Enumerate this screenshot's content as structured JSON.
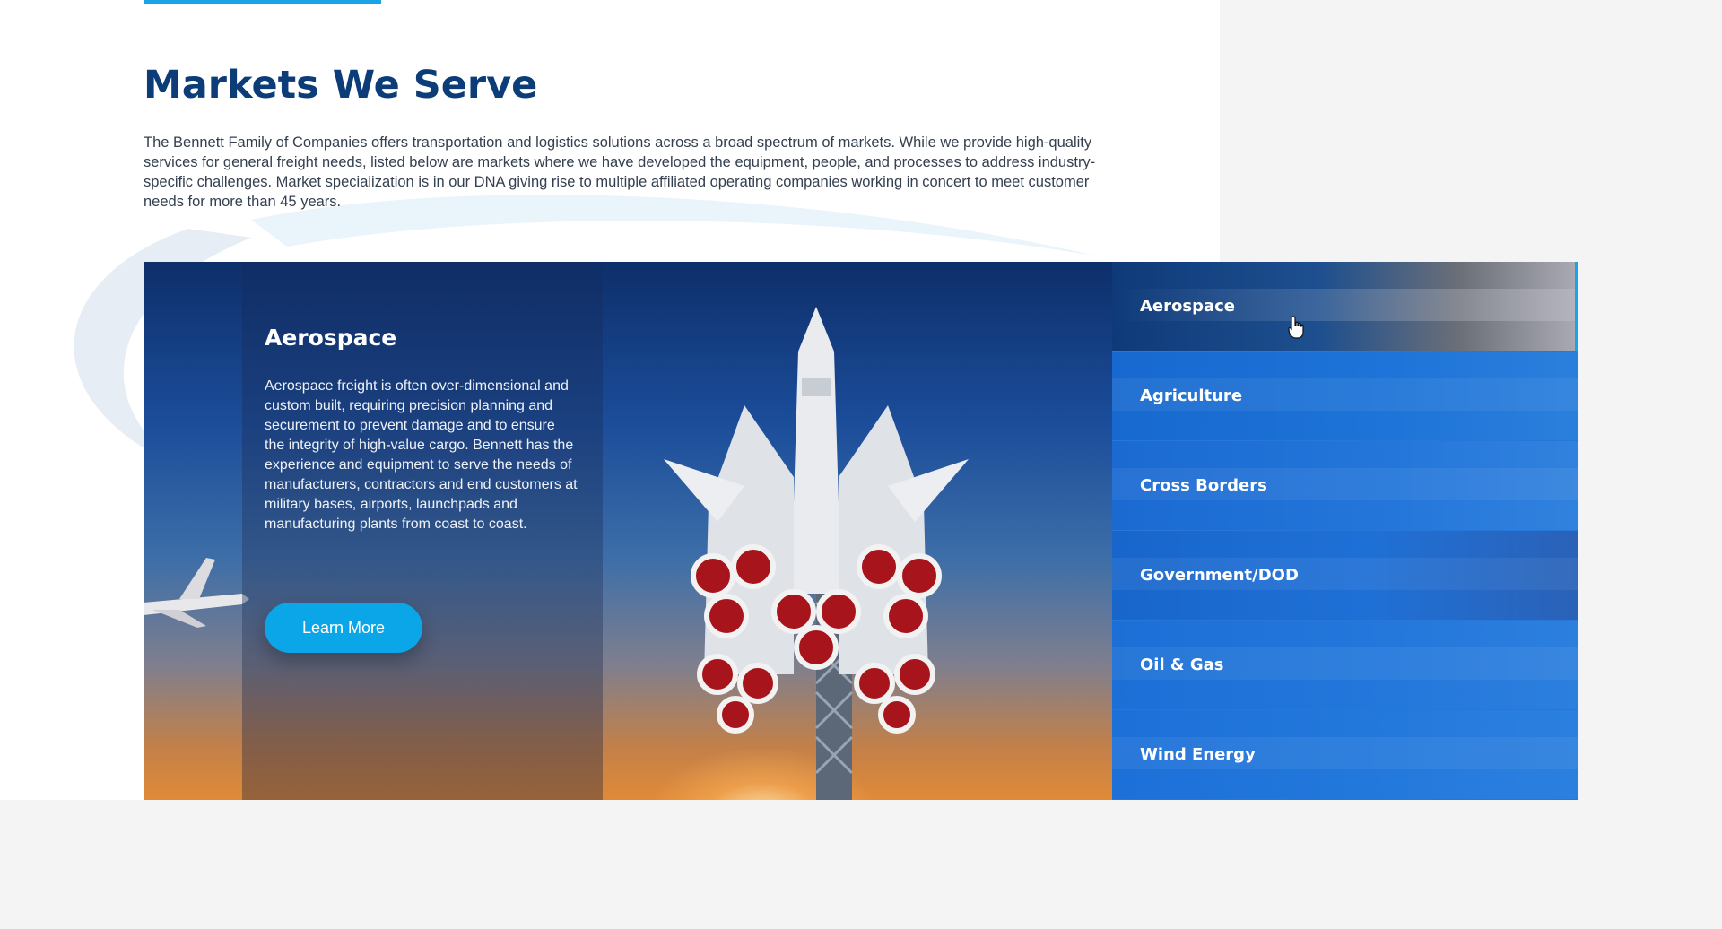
{
  "page": {
    "title": "Markets We Serve",
    "intro": "The Bennett Family of Companies offers transportation and logistics solutions across a broad spectrum of markets. While we provide high-quality services for general freight needs, listed below are markets where we have developed the equipment, people, and processes to address industry-specific challenges. Market specialization is in our DNA giving rise to multiple affiliated operating companies working in concert to meet customer needs for more than 45 years."
  },
  "feature": {
    "title": "Aerospace",
    "body": "Aerospace freight is often over-dimensional and custom built, requiring precision planning and securement to prevent damage and to ensure the integrity of high-value cargo. Bennett has the experience and equipment to serve the needs of manufacturers, contractors and end customers at military bases, airports, launchpads and manufacturing plants from coast to coast.",
    "button_label": "Learn More",
    "image_icon": "rocket-launch-image"
  },
  "markets": {
    "items": [
      {
        "label": "Aerospace",
        "active": true
      },
      {
        "label": "Agriculture",
        "active": false
      },
      {
        "label": "Cross Borders",
        "active": false
      },
      {
        "label": "Government/DOD",
        "active": false
      },
      {
        "label": "Oil & Gas",
        "active": false
      },
      {
        "label": "Wind Energy",
        "active": false
      }
    ]
  },
  "colors": {
    "title": "#0d3d78",
    "accent": "#1aa3e6",
    "button": "#0aa6e8",
    "list_background": "#1a6fd6",
    "body_text": "#344050"
  }
}
